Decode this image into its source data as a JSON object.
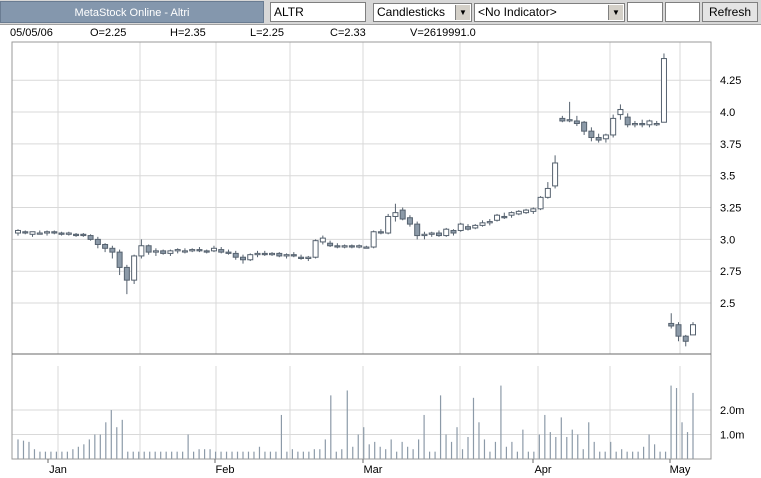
{
  "toolbar": {
    "title": "MetaStock Online - Altri",
    "symbol_value": "ALTR",
    "chart_type": "Candlesticks",
    "indicator": "<No Indicator>",
    "refresh_label": "Refresh"
  },
  "info": {
    "date": "05/05/06",
    "open": "O=2.25",
    "high": "H=2.35",
    "low": "L=2.25",
    "close": "C=2.33",
    "volume": "V=2619991.0"
  },
  "colors": {
    "candle": "#8c9aa8",
    "candle_edge": "#56626f",
    "volume": "#8c9aa8",
    "grid": "#d9d9d9",
    "frame": "#9a9a9a"
  },
  "chart_data": [
    {
      "type": "candlestick",
      "title": "",
      "ylim": [
        2.1,
        4.55
      ],
      "yticks": [
        "4.25",
        "4.0",
        "3.75",
        "3.5",
        "3.25",
        "3.0",
        "2.75",
        "2.5"
      ],
      "yticks_values": [
        4.25,
        4.0,
        3.75,
        3.5,
        3.25,
        3.0,
        2.75,
        2.5
      ],
      "xticks": [
        "Jan",
        "Feb",
        "Mar",
        "Apr",
        "May"
      ],
      "grid": true,
      "candles": [
        [
          3.05,
          3.08,
          3.03,
          3.07
        ],
        [
          3.06,
          3.07,
          3.04,
          3.05
        ],
        [
          3.04,
          3.06,
          3.02,
          3.06
        ],
        [
          3.05,
          3.07,
          3.04,
          3.05
        ],
        [
          3.05,
          3.07,
          3.03,
          3.06
        ],
        [
          3.06,
          3.07,
          3.04,
          3.05
        ],
        [
          3.05,
          3.06,
          3.03,
          3.04
        ],
        [
          3.04,
          3.06,
          3.03,
          3.05
        ],
        [
          3.04,
          3.05,
          3.02,
          3.03
        ],
        [
          3.04,
          3.05,
          3.02,
          3.03
        ],
        [
          3.03,
          3.04,
          2.99,
          3.0
        ],
        [
          3.0,
          3.02,
          2.93,
          2.96
        ],
        [
          2.96,
          2.97,
          2.9,
          2.93
        ],
        [
          2.93,
          2.95,
          2.85,
          2.9
        ],
        [
          2.9,
          2.92,
          2.72,
          2.78
        ],
        [
          2.78,
          2.8,
          2.57,
          2.68
        ],
        [
          2.68,
          2.88,
          2.65,
          2.87
        ],
        [
          2.87,
          3.0,
          2.85,
          2.95
        ],
        [
          2.95,
          2.96,
          2.88,
          2.9
        ],
        [
          2.9,
          2.93,
          2.87,
          2.91
        ],
        [
          2.91,
          2.92,
          2.88,
          2.89
        ],
        [
          2.89,
          2.92,
          2.87,
          2.91
        ],
        [
          2.91,
          2.93,
          2.89,
          2.92
        ],
        [
          2.91,
          2.93,
          2.89,
          2.91
        ],
        [
          2.91,
          2.93,
          2.9,
          2.92
        ],
        [
          2.92,
          2.94,
          2.9,
          2.91
        ],
        [
          2.91,
          2.92,
          2.89,
          2.9
        ],
        [
          2.91,
          2.95,
          2.9,
          2.93
        ],
        [
          2.92,
          2.94,
          2.89,
          2.9
        ],
        [
          2.9,
          2.92,
          2.88,
          2.89
        ],
        [
          2.89,
          2.91,
          2.84,
          2.86
        ],
        [
          2.86,
          2.88,
          2.81,
          2.84
        ],
        [
          2.84,
          2.89,
          2.83,
          2.88
        ],
        [
          2.88,
          2.91,
          2.86,
          2.89
        ],
        [
          2.89,
          2.91,
          2.87,
          2.88
        ],
        [
          2.88,
          2.9,
          2.87,
          2.89
        ],
        [
          2.89,
          2.9,
          2.86,
          2.87
        ],
        [
          2.87,
          2.89,
          2.85,
          2.88
        ],
        [
          2.88,
          2.9,
          2.86,
          2.87
        ],
        [
          2.86,
          2.88,
          2.84,
          2.85
        ],
        [
          2.85,
          2.87,
          2.83,
          2.86
        ],
        [
          2.86,
          3.0,
          2.85,
          2.99
        ],
        [
          2.98,
          3.03,
          2.96,
          3.01
        ],
        [
          2.97,
          2.99,
          2.94,
          2.95
        ],
        [
          2.95,
          2.97,
          2.93,
          2.94
        ],
        [
          2.94,
          2.96,
          2.93,
          2.95
        ],
        [
          2.95,
          2.96,
          2.93,
          2.94
        ],
        [
          2.94,
          2.96,
          2.93,
          2.95
        ],
        [
          2.94,
          2.95,
          2.93,
          2.94
        ],
        [
          2.94,
          3.07,
          2.93,
          3.06
        ],
        [
          3.06,
          3.08,
          3.04,
          3.05
        ],
        [
          3.05,
          3.2,
          3.04,
          3.18
        ],
        [
          3.18,
          3.28,
          3.14,
          3.21
        ],
        [
          3.23,
          3.25,
          3.15,
          3.16
        ],
        [
          3.17,
          3.19,
          3.1,
          3.12
        ],
        [
          3.12,
          3.14,
          3.0,
          3.03
        ],
        [
          3.03,
          3.06,
          3.0,
          3.04
        ],
        [
          3.04,
          3.06,
          3.02,
          3.05
        ],
        [
          3.05,
          3.07,
          3.02,
          3.03
        ],
        [
          3.03,
          3.09,
          3.02,
          3.08
        ],
        [
          3.07,
          3.08,
          3.03,
          3.05
        ],
        [
          3.07,
          3.13,
          3.06,
          3.12
        ],
        [
          3.1,
          3.12,
          3.07,
          3.08
        ],
        [
          3.09,
          3.12,
          3.08,
          3.11
        ],
        [
          3.11,
          3.15,
          3.1,
          3.13
        ],
        [
          3.13,
          3.16,
          3.11,
          3.14
        ],
        [
          3.15,
          3.2,
          3.14,
          3.19
        ],
        [
          3.18,
          3.21,
          3.16,
          3.17
        ],
        [
          3.19,
          3.22,
          3.17,
          3.21
        ],
        [
          3.2,
          3.23,
          3.19,
          3.22
        ],
        [
          3.21,
          3.24,
          3.2,
          3.23
        ],
        [
          3.22,
          3.25,
          3.2,
          3.24
        ],
        [
          3.24,
          3.34,
          3.23,
          3.33
        ],
        [
          3.33,
          3.45,
          3.32,
          3.4
        ],
        [
          3.42,
          3.66,
          3.4,
          3.6
        ],
        [
          3.95,
          3.97,
          3.92,
          3.93
        ],
        [
          3.94,
          4.08,
          3.92,
          3.94
        ],
        [
          3.93,
          3.97,
          3.89,
          3.91
        ],
        [
          3.92,
          3.93,
          3.82,
          3.85
        ],
        [
          3.85,
          3.88,
          3.77,
          3.8
        ],
        [
          3.8,
          3.83,
          3.76,
          3.78
        ],
        [
          3.79,
          3.83,
          3.76,
          3.82
        ],
        [
          3.82,
          3.98,
          3.8,
          3.95
        ],
        [
          3.98,
          4.06,
          3.94,
          4.02
        ],
        [
          3.96,
          3.99,
          3.88,
          3.9
        ],
        [
          3.9,
          3.93,
          3.88,
          3.91
        ],
        [
          3.91,
          3.94,
          3.88,
          3.9
        ],
        [
          3.9,
          3.94,
          3.88,
          3.93
        ],
        [
          3.9,
          3.93,
          3.89,
          3.91
        ],
        [
          3.92,
          4.46,
          3.92,
          4.42
        ],
        [
          2.34,
          2.42,
          2.3,
          2.32
        ],
        [
          2.33,
          2.35,
          2.2,
          2.24
        ],
        [
          2.24,
          2.25,
          2.16,
          2.2
        ],
        [
          2.25,
          2.35,
          2.25,
          2.33
        ]
      ],
      "volume": {
        "ylim": [
          0,
          3.8
        ],
        "yticks": [
          "2.0m",
          "1.0m"
        ],
        "yticks_values": [
          2.0,
          1.0
        ],
        "unit": "millions",
        "values": [
          0.8,
          0.75,
          0.7,
          0.4,
          0.3,
          0.3,
          0.3,
          0.3,
          0.3,
          0.3,
          0.4,
          0.5,
          0.6,
          0.8,
          1.0,
          1.0,
          1.5,
          2.0,
          1.3,
          1.6,
          0.3,
          0.3,
          0.3,
          0.3,
          0.3,
          0.3,
          0.3,
          0.3,
          0.3,
          0.3,
          0.3,
          1.0,
          0.3,
          0.4,
          0.4,
          0.4,
          0.3,
          0.3,
          0.3,
          0.3,
          0.3,
          0.3,
          0.3,
          0.3,
          0.5,
          0.3,
          0.3,
          0.3,
          1.8,
          0.3,
          0.4,
          0.3,
          0.3,
          0.3,
          0.4,
          0.4,
          0.8,
          2.6,
          0.3,
          0.4,
          2.8,
          0.5,
          1.0,
          1.3,
          0.6,
          0.7,
          0.5,
          0.4,
          0.8,
          0.3,
          0.7,
          0.5,
          0.4,
          0.8,
          1.8,
          0.3,
          0.3,
          2.6,
          1.0,
          0.7,
          1.3,
          0.4,
          0.9,
          2.5,
          1.5,
          0.8,
          0.3,
          0.7,
          3.0,
          0.5,
          0.7,
          0.3,
          1.2,
          0.3,
          0.3,
          1.0,
          1.8,
          1.1,
          0.9,
          1.7,
          0.9,
          1.2,
          1.0,
          0.4,
          1.5,
          0.7,
          0.3,
          0.3,
          0.7,
          0.3,
          0.4,
          0.3,
          0.3,
          0.3,
          0.5,
          1.0,
          0.6,
          0.3,
          0.3,
          3.0,
          2.9,
          1.5,
          1.1,
          2.7
        ]
      }
    }
  ]
}
